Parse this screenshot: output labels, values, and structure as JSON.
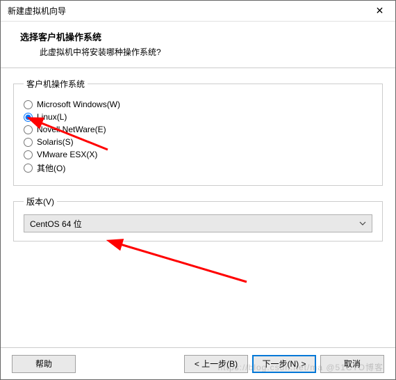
{
  "window": {
    "title": "新建虚拟机向导",
    "close_glyph": "✕"
  },
  "header": {
    "title": "选择客户机操作系统",
    "subtitle": "此虚拟机中将安装哪种操作系统?"
  },
  "os_group": {
    "legend": "客户机操作系统",
    "options": [
      {
        "label": "Microsoft Windows(W)",
        "checked": false
      },
      {
        "label": "Linux(L)",
        "checked": true
      },
      {
        "label": "Novell NetWare(E)",
        "checked": false
      },
      {
        "label": "Solaris(S)",
        "checked": false
      },
      {
        "label": "VMware ESX(X)",
        "checked": false
      },
      {
        "label": "其他(O)",
        "checked": false
      }
    ]
  },
  "version_group": {
    "legend": "版本(V)",
    "selected": "CentOS 64 位"
  },
  "footer": {
    "help": "帮助",
    "back": "< 上一步(B)",
    "next": "下一步(N) >",
    "cancel": "取消"
  },
  "watermark": "https://blog.csdn.net/ma @51CTO博客"
}
